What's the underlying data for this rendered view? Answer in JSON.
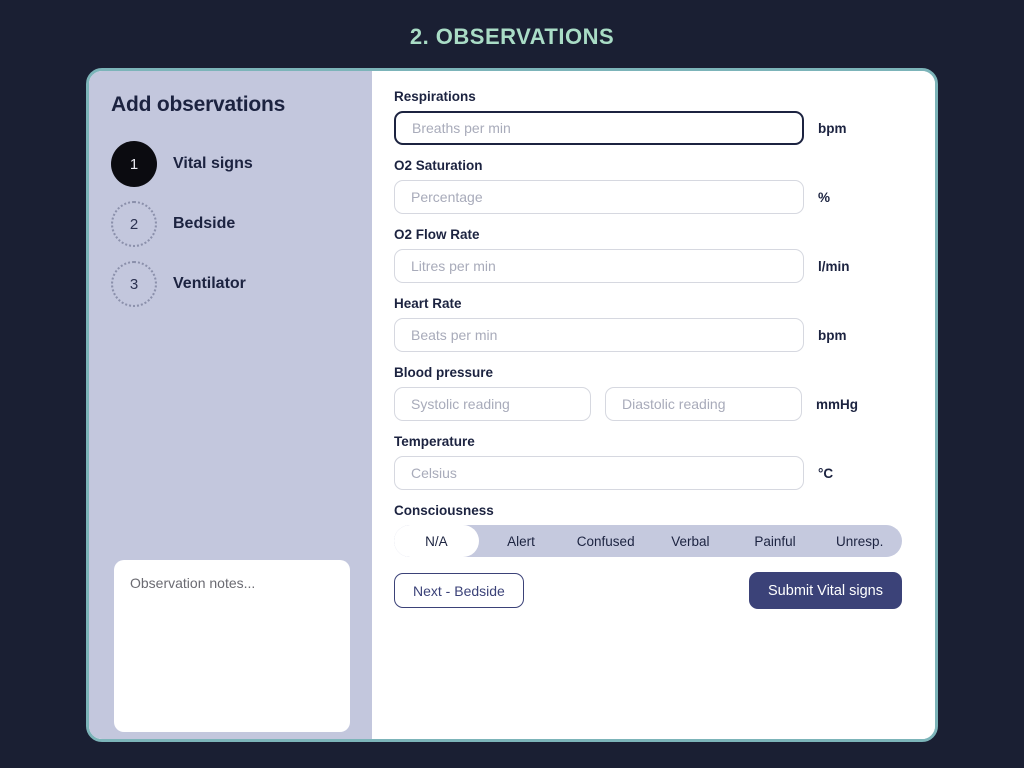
{
  "page": {
    "title": "2. OBSERVATIONS",
    "title_color": "#a9dcc6",
    "background_color": "#1a1f33",
    "card_border_color": "#7cb4b9"
  },
  "sidebar": {
    "heading": "Add observations",
    "background_color": "#c3c7dd",
    "steps": [
      {
        "number": "1",
        "label": "Vital signs",
        "state": "active"
      },
      {
        "number": "2",
        "label": "Bedside",
        "state": "inactive"
      },
      {
        "number": "3",
        "label": "Ventilator",
        "state": "inactive"
      }
    ],
    "notes": {
      "placeholder": "Observation notes...",
      "value": ""
    }
  },
  "form": {
    "fields": [
      {
        "label": "Respirations",
        "placeholder": "Breaths per min",
        "value": "",
        "unit": "bpm",
        "focused": true
      },
      {
        "label": "O2 Saturation",
        "placeholder": "Percentage",
        "value": "",
        "unit": "%",
        "focused": false
      },
      {
        "label": "O2 Flow Rate",
        "placeholder": "Litres per min",
        "value": "",
        "unit": "l/min",
        "focused": false
      },
      {
        "label": "Heart Rate",
        "placeholder": "Beats per min",
        "value": "",
        "unit": "bpm",
        "focused": false
      }
    ],
    "blood_pressure": {
      "label": "Blood pressure",
      "systolic_placeholder": "Systolic reading",
      "systolic_value": "",
      "diastolic_placeholder": "Diastolic reading",
      "diastolic_value": "",
      "unit": "mmHg"
    },
    "temperature": {
      "label": "Temperature",
      "placeholder": "Celsius",
      "value": "",
      "unit": "°C"
    },
    "consciousness": {
      "label": "Consciousness",
      "options": [
        "N/A",
        "Alert",
        "Confused",
        "Verbal",
        "Painful",
        "Unresp."
      ],
      "selected": "N/A",
      "track_color": "#c5c9de"
    }
  },
  "footer": {
    "next_label": "Next - Bedside",
    "submit_label": "Submit Vital signs",
    "submit_color": "#3b4278"
  }
}
